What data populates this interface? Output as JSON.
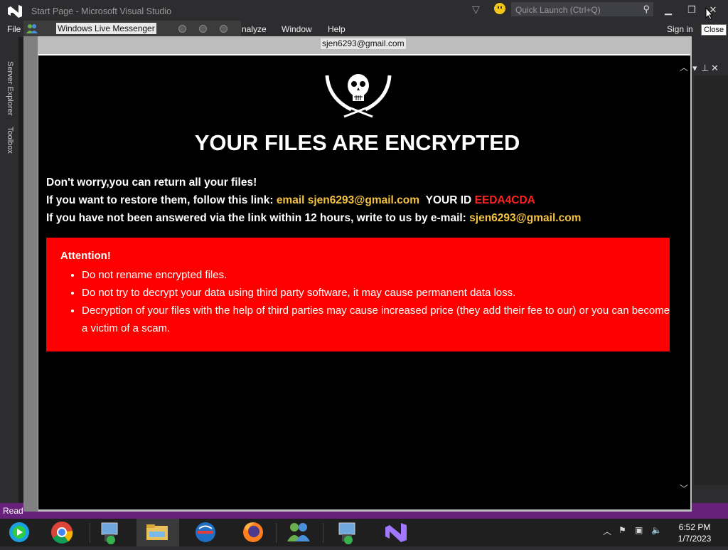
{
  "vs": {
    "title": "Start Page - Microsoft Visual Studio",
    "quick_launch_placeholder": "Quick Launch (Ctrl+Q)",
    "menu": {
      "file": "File",
      "analyze": "nalyze",
      "window": "Window",
      "help": "Help"
    },
    "sign_in": "Sign in",
    "close_tooltip": "Close",
    "left_tabs": [
      "Server Explorer",
      "Toolbox"
    ],
    "status_text": "Read",
    "purple": "#68217a"
  },
  "messenger": {
    "title": "Windows Live Messenger",
    "email_banner": "sjen6293@gmail.com"
  },
  "ransom": {
    "headline": "YOUR FILES ARE ENCRYPTED",
    "line1": "Don't worry,you can return all your files!",
    "line2_prefix": "If you want to restore them, follow this link:",
    "line2_link": "email sjen6293@gmail.com",
    "line2_id_label": "YOUR ID",
    "line2_id": "EEDA4CDA",
    "line3_prefix": "If you have not been answered via the link within 12 hours, write to us by e-mail:",
    "line3_email": "sjen6293@gmail.com",
    "attention_title": "Attention!",
    "attention_items": [
      "Do not rename encrypted files.",
      "Do not try to decrypt your data using third party software, it may cause permanent data loss.",
      "Decryption of your files with the help of third parties may cause increased price (they add their fee to our) or you can become a victim of a scam."
    ],
    "colors": {
      "background": "#000000",
      "alert": "#ff0000",
      "highlight": "#f5c341",
      "id": "#ff2222"
    }
  },
  "taskbar": {
    "apps": [
      "media-center-icon",
      "chrome-icon",
      "network-installer-icon",
      "file-explorer-icon",
      "opera-icon",
      "firefox-icon",
      "messenger-icon",
      "installer-icon",
      "visual-studio-icon"
    ],
    "time": "6:52 PM",
    "date": "1/7/2023"
  }
}
